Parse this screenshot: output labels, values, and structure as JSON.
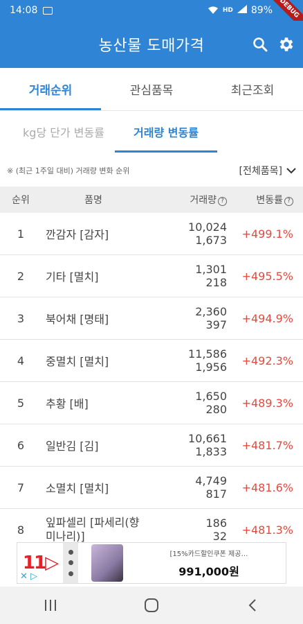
{
  "status_bar": {
    "time": "14:08",
    "battery": "89%",
    "network": "HD",
    "debug_label": "DEBUG"
  },
  "app_bar": {
    "title": "농산물 도매가격"
  },
  "tabs": [
    {
      "label": "거래순위",
      "active": true
    },
    {
      "label": "관심품목",
      "active": false
    },
    {
      "label": "최근조회",
      "active": false
    }
  ],
  "sub_tabs": [
    {
      "label": "kg당 단가 변동률",
      "active": false
    },
    {
      "label": "거래량 변동률",
      "active": true
    }
  ],
  "filter": {
    "note": "※ (최근 1주일 대비) 거래량 변화 순위",
    "dropdown_value": "[전체품목]"
  },
  "table": {
    "headers": {
      "rank": "순위",
      "name": "품명",
      "volume": "거래량",
      "rate": "변동률"
    },
    "rows": [
      {
        "rank": "1",
        "name": "깐감자 [감자]",
        "vol_now": "10,024",
        "vol_prev": "1,673",
        "rate": "+499.1%"
      },
      {
        "rank": "2",
        "name": "기타 [멸치]",
        "vol_now": "1,301",
        "vol_prev": "218",
        "rate": "+495.5%"
      },
      {
        "rank": "3",
        "name": "북어채 [명태]",
        "vol_now": "2,360",
        "vol_prev": "397",
        "rate": "+494.9%"
      },
      {
        "rank": "4",
        "name": "중멸치 [멸치]",
        "vol_now": "11,586",
        "vol_prev": "1,956",
        "rate": "+492.3%"
      },
      {
        "rank": "5",
        "name": "추황 [배]",
        "vol_now": "1,650",
        "vol_prev": "280",
        "rate": "+489.3%"
      },
      {
        "rank": "6",
        "name": "일반김 [김]",
        "vol_now": "10,661",
        "vol_prev": "1,833",
        "rate": "+481.7%"
      },
      {
        "rank": "7",
        "name": "소멸치 [멸치]",
        "vol_now": "4,749",
        "vol_prev": "817",
        "rate": "+481.6%"
      },
      {
        "rank": "8",
        "name": "잎파셀리 [파세리(향미나리)]",
        "vol_now": "186",
        "vol_prev": "32",
        "rate": "+481.3%"
      }
    ]
  },
  "ad": {
    "brand": "11▷",
    "promo": "[15%카드할인쿠폰 제공…",
    "price": "991,000원"
  },
  "colors": {
    "primary": "#2f84d6",
    "increase": "#e4493f"
  }
}
